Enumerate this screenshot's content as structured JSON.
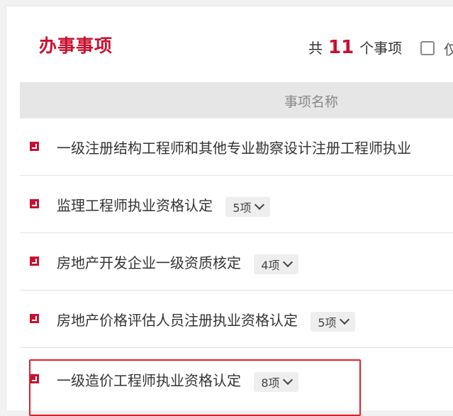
{
  "header": {
    "title": "办事事项",
    "count_prefix": "共",
    "count_value": "11",
    "count_suffix": "个事项",
    "cut_text": "仅"
  },
  "table": {
    "column_header": "事项名称",
    "rows": [
      {
        "label": "一级注册结构工程师和其他专业勘察设计注册工程师执业",
        "badge": ""
      },
      {
        "label": "监理工程师执业资格认定",
        "badge": "5项"
      },
      {
        "label": "房地产开发企业一级资质核定",
        "badge": "4项"
      },
      {
        "label": "房地产价格评估人员注册执业资格认定",
        "badge": "5项"
      },
      {
        "label": "一级造价工程师执业资格认定",
        "badge": "8项"
      }
    ]
  },
  "colors": {
    "accent": "#c8102e",
    "highlight_border": "#e21f26"
  },
  "icons": {
    "row": "arrow-square-icon",
    "badge": "chevron-down-icon"
  }
}
